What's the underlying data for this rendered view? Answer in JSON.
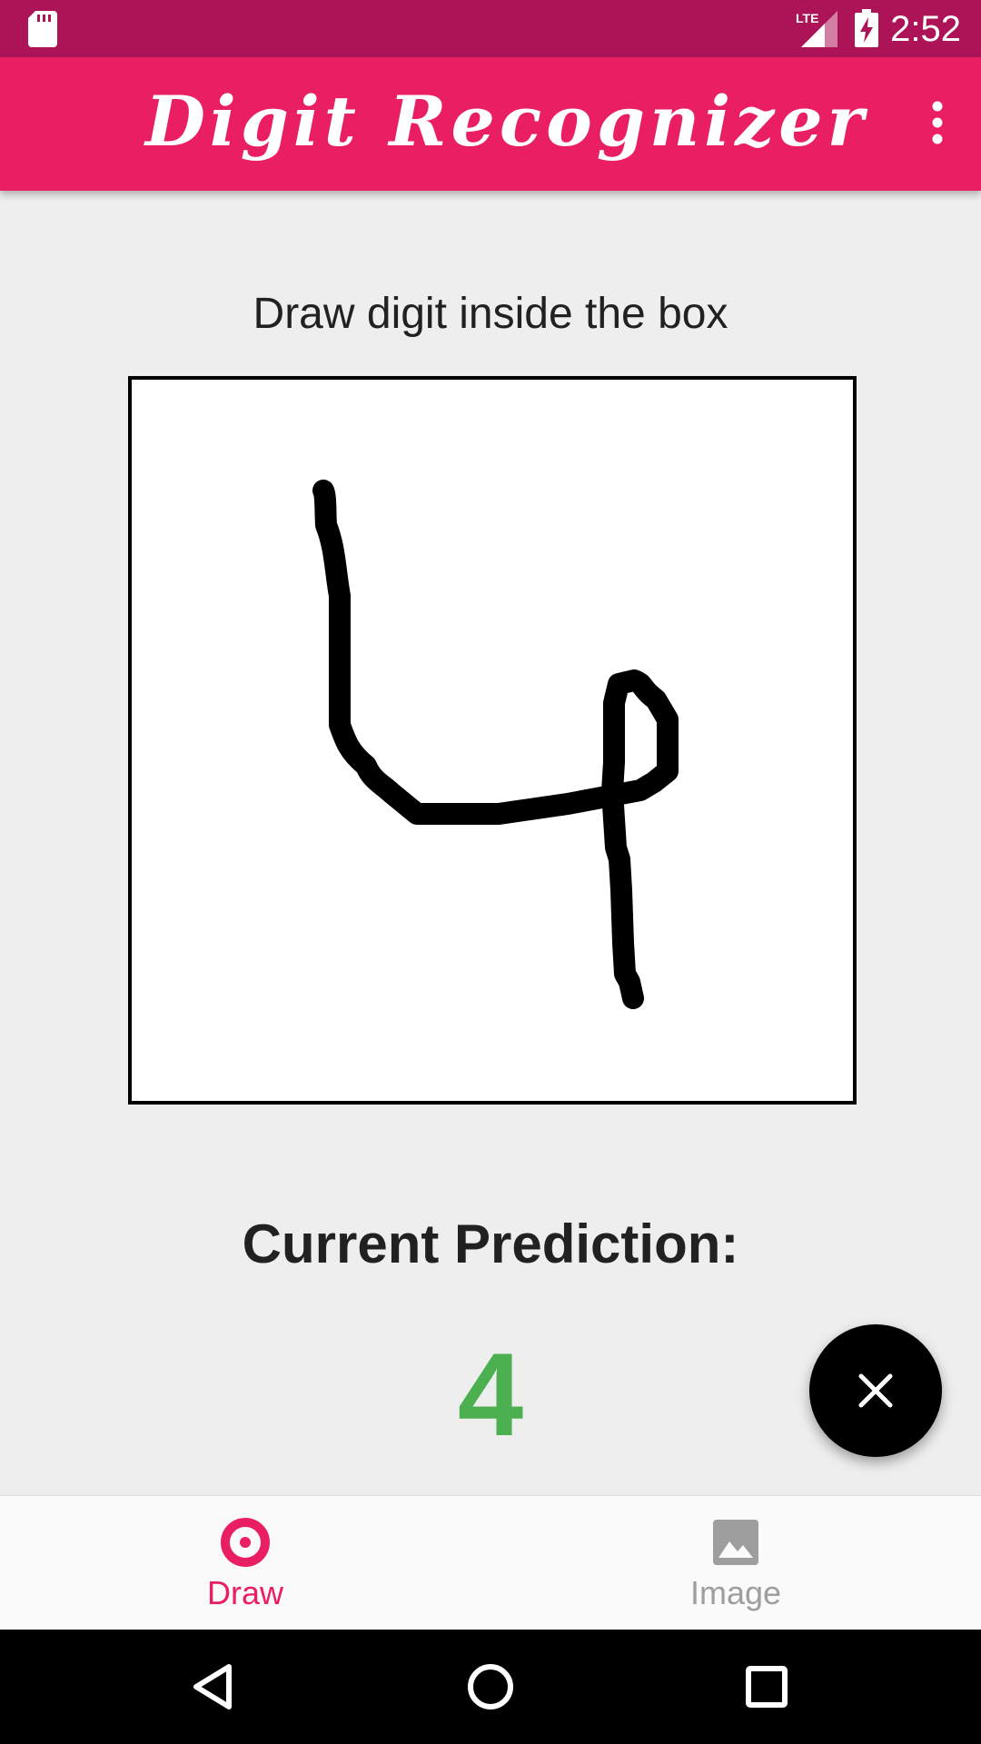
{
  "status_bar": {
    "time": "2:52",
    "network_label": "LTE",
    "icons": [
      "sd-card-icon",
      "lte-signal-icon",
      "battery-charging-icon"
    ]
  },
  "app_bar": {
    "title": "Digit Recognizer",
    "menu_icon": "more-vert-icon"
  },
  "main": {
    "instruction": "Draw digit inside the box",
    "prediction_label": "Current Prediction:",
    "prediction_value": "4"
  },
  "fab": {
    "icon": "close-icon"
  },
  "bottom_nav": {
    "items": [
      {
        "label": "Draw",
        "icon": "draw-radio-icon",
        "active": true
      },
      {
        "label": "Image",
        "icon": "image-icon",
        "active": false
      }
    ]
  },
  "system_nav": {
    "icons": [
      "back-icon",
      "home-icon",
      "recents-icon"
    ]
  },
  "colors": {
    "primary": "#e91e63",
    "primary_dark": "#ad1457",
    "prediction": "#4caf50",
    "inactive": "#9e9e9e"
  }
}
